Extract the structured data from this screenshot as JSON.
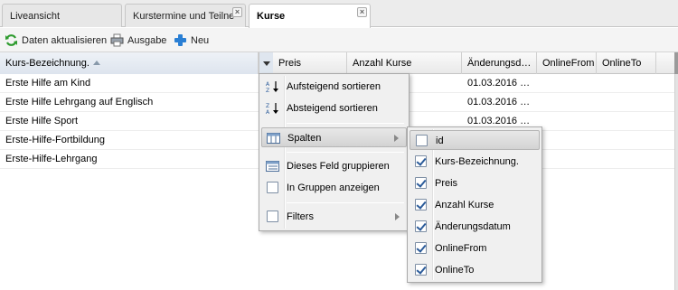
{
  "tabs": [
    {
      "label": "Liveansicht",
      "active": false,
      "closable": false
    },
    {
      "label": "Kurstermine und Teilne",
      "active": false,
      "closable": true
    },
    {
      "label": "Kurse",
      "active": true,
      "closable": true
    }
  ],
  "toolbar": {
    "refresh_label": "Daten aktualisieren",
    "print_label": "Ausgabe",
    "new_label": "Neu"
  },
  "grid": {
    "columns": [
      "Kurs-Bezeichnung.",
      "Preis",
      "Anzahl Kurse",
      "Änderungsd…",
      "OnlineFrom",
      "OnlineTo"
    ],
    "rows": [
      {
        "name": "Erste Hilfe am Kind",
        "date": "01.03.2016 …"
      },
      {
        "name": "Erste Hilfe Lehrgang auf Englisch",
        "date": "01.03.2016 …"
      },
      {
        "name": "Erste Hilfe Sport",
        "date": "01.03.2016 …"
      },
      {
        "name": "Erste-Hilfe-Fortbildung",
        "date": ""
      },
      {
        "name": "Erste-Hilfe-Lehrgang",
        "date": ""
      }
    ]
  },
  "column_menu": {
    "sort_asc": "Aufsteigend sortieren",
    "sort_desc": "Absteigend sortieren",
    "columns": "Spalten",
    "group_by": "Dieses Feld gruppieren",
    "show_in_groups": "In Gruppen anzeigen",
    "filters": "Filters"
  },
  "columns_submenu": [
    {
      "label": "id",
      "checked": false
    },
    {
      "label": "Kurs-Bezeichnung.",
      "checked": true
    },
    {
      "label": "Preis",
      "checked": true
    },
    {
      "label": "Anzahl Kurse",
      "checked": true
    },
    {
      "label": "Änderungsdatum",
      "checked": true
    },
    {
      "label": "OnlineFrom",
      "checked": true
    },
    {
      "label": "OnlineTo",
      "checked": true
    }
  ],
  "colors": {
    "accent_blue": "#2b5b9a",
    "refresh_green": "#2e9b2e",
    "new_blue": "#2a7fd4"
  },
  "icons": [
    "refresh-icon",
    "print-icon",
    "plus-icon",
    "sort-asc-icon",
    "sort-desc-icon",
    "columns-icon",
    "group-icon",
    "close-icon"
  ]
}
